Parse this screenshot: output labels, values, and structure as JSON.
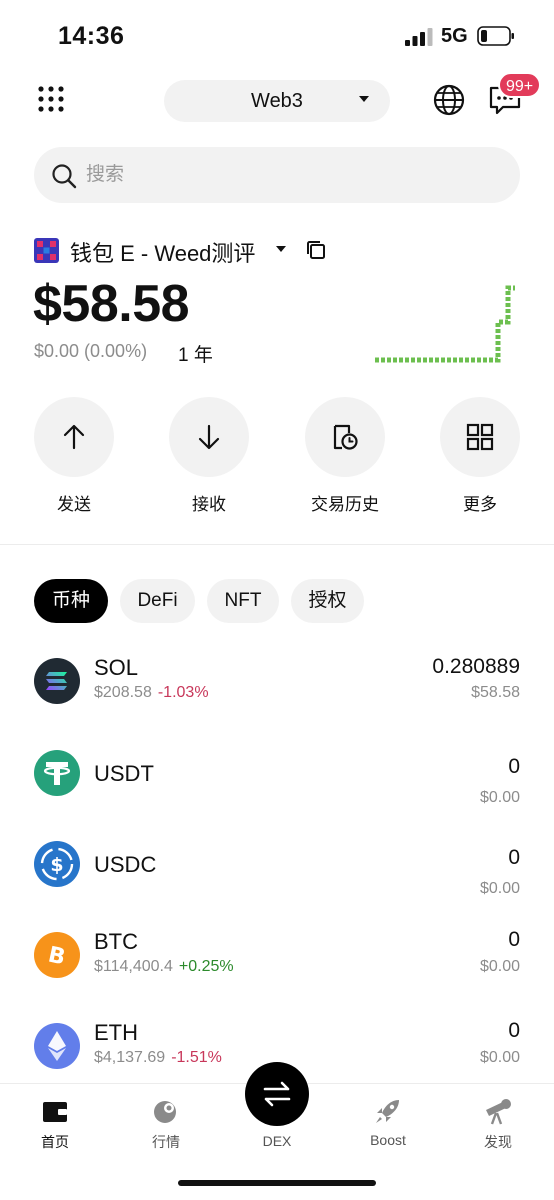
{
  "status_bar": {
    "time": "14:36",
    "network": "5G"
  },
  "header": {
    "segment_label": "Web3",
    "badge": "99+"
  },
  "search": {
    "placeholder": "搜索"
  },
  "wallet": {
    "name": "钱包 E - Weed测评",
    "balance": "$58.58",
    "pnl": "$0.00 (0.00%)",
    "period": "1 年"
  },
  "actions": [
    {
      "label": "发送",
      "icon": "arrow-up-icon"
    },
    {
      "label": "接收",
      "icon": "arrow-down-icon"
    },
    {
      "label": "交易历史",
      "icon": "history-icon"
    },
    {
      "label": "更多",
      "icon": "grid-icon"
    }
  ],
  "tabs": [
    {
      "label": "币种",
      "active": true
    },
    {
      "label": "DeFi",
      "active": false
    },
    {
      "label": "NFT",
      "active": false
    },
    {
      "label": "授权",
      "active": false
    }
  ],
  "tokens": [
    {
      "symbol": "SOL",
      "price": "$208.58",
      "change": "-1.03%",
      "amount": "0.280889",
      "fiat": "$58.58",
      "icon": "solana-logo-icon"
    },
    {
      "symbol": "USDT",
      "price": "",
      "change": "",
      "amount": "0",
      "fiat": "$0.00",
      "icon": "tether-logo-icon"
    },
    {
      "symbol": "USDC",
      "price": "",
      "change": "",
      "amount": "0",
      "fiat": "$0.00",
      "icon": "usdc-logo-icon"
    },
    {
      "symbol": "BTC",
      "price": "$114,400.4",
      "change": "+0.25%",
      "amount": "0",
      "fiat": "$0.00",
      "icon": "bitcoin-logo-icon"
    },
    {
      "symbol": "ETH",
      "price": "$4,137.69",
      "change": "-1.51%",
      "amount": "0",
      "fiat": "$0.00",
      "icon": "ethereum-logo-icon"
    }
  ],
  "bottom_nav": [
    {
      "label": "首页",
      "icon": "wallet-icon",
      "active": true
    },
    {
      "label": "行情",
      "icon": "market-icon",
      "active": false
    },
    {
      "label": "DEX",
      "icon": "swap-icon",
      "active": false
    },
    {
      "label": "Boost",
      "icon": "rocket-icon",
      "active": false
    },
    {
      "label": "发现",
      "icon": "telescope-icon",
      "active": false
    }
  ],
  "colors": {
    "negative": "#c8375a",
    "positive": "#2c8a2c",
    "sparkline": "#6cbf4f",
    "badge": "#e23b5a"
  }
}
